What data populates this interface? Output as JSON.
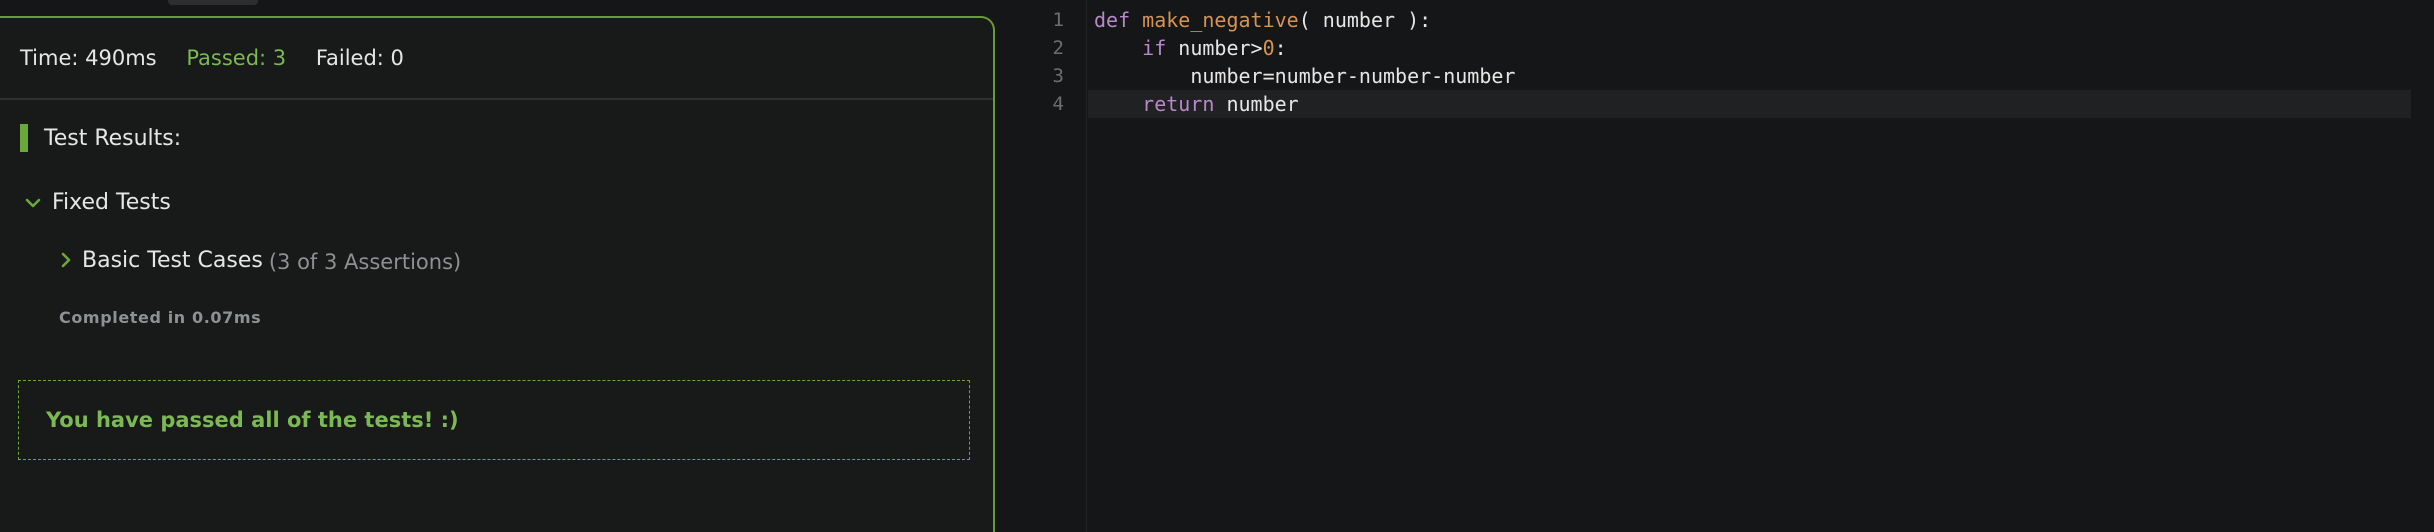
{
  "results": {
    "stats": {
      "time": "Time: 490ms",
      "passed": "Passed: 3",
      "failed": "Failed: 0"
    },
    "heading": "Test Results:",
    "group": {
      "label": "Fixed Tests",
      "expanded": true
    },
    "test_case": {
      "name": "Basic Test Cases",
      "assertions": "(3 of 3 Assertions)",
      "expanded": false
    },
    "completed": "Completed in 0.07ms",
    "success_message": "You have passed all of the tests! :)"
  },
  "editor": {
    "line_numbers": [
      "1",
      "2",
      "3",
      "4"
    ],
    "lines": [
      {
        "tokens": [
          {
            "text": "def ",
            "kind": "kw"
          },
          {
            "text": "make_negative",
            "kind": "fn"
          },
          {
            "text": "( number ):",
            "kind": "plain"
          }
        ]
      },
      {
        "tokens": [
          {
            "text": "    ",
            "kind": "plain"
          },
          {
            "text": "if",
            "kind": "kw"
          },
          {
            "text": " number>",
            "kind": "plain"
          },
          {
            "text": "0",
            "kind": "num"
          },
          {
            "text": ":",
            "kind": "plain"
          }
        ]
      },
      {
        "tokens": [
          {
            "text": "        number=number-number-number",
            "kind": "plain"
          }
        ]
      },
      {
        "tokens": [
          {
            "text": "    ",
            "kind": "plain"
          },
          {
            "text": "return",
            "kind": "kw"
          },
          {
            "text": " number",
            "kind": "plain"
          }
        ]
      }
    ],
    "active_line": 4
  },
  "colors": {
    "accent_green": "#6aa83c",
    "passed_text": "#7cb854",
    "keyword": "#b889c8",
    "function_name": "#d79353",
    "number_literal": "#d79353"
  },
  "icons": {
    "group_chevron": "chevron-down-icon",
    "case_chevron": "chevron-right-icon"
  }
}
